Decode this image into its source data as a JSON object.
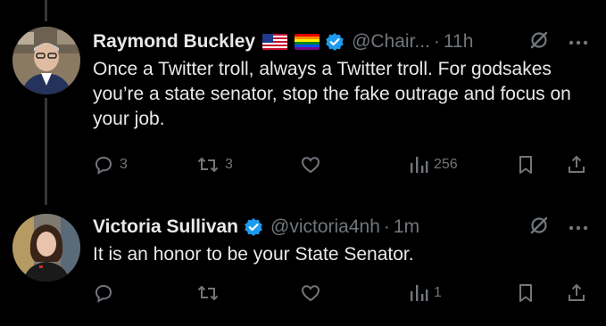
{
  "tweets": [
    {
      "name": "Raymond Buckley",
      "handle": "@Chair...",
      "time": "11h",
      "text": "Once a Twitter troll, always a Twitter troll. For godsakes you’re a  state senator, stop the fake outrage and focus on your job.",
      "replies": "3",
      "retweets": "3",
      "likes": "",
      "views": "256"
    },
    {
      "name": "Victoria Sullivan",
      "handle": "@victoria4nh",
      "time": "1m",
      "text": "It is an honor to be your State Senator.",
      "replies": "",
      "retweets": "",
      "likes": "",
      "views": "1"
    }
  ],
  "colors": {
    "background": "#000000",
    "text": "#e7e9ea",
    "secondary": "#71767b",
    "verified": "#1d9bf0"
  },
  "icons": [
    "reply-icon",
    "retweet-icon",
    "like-icon",
    "views-icon",
    "bookmark-icon",
    "share-icon",
    "grok-icon",
    "more-icon",
    "verified-icon"
  ],
  "meta": {
    "separator": "·"
  }
}
